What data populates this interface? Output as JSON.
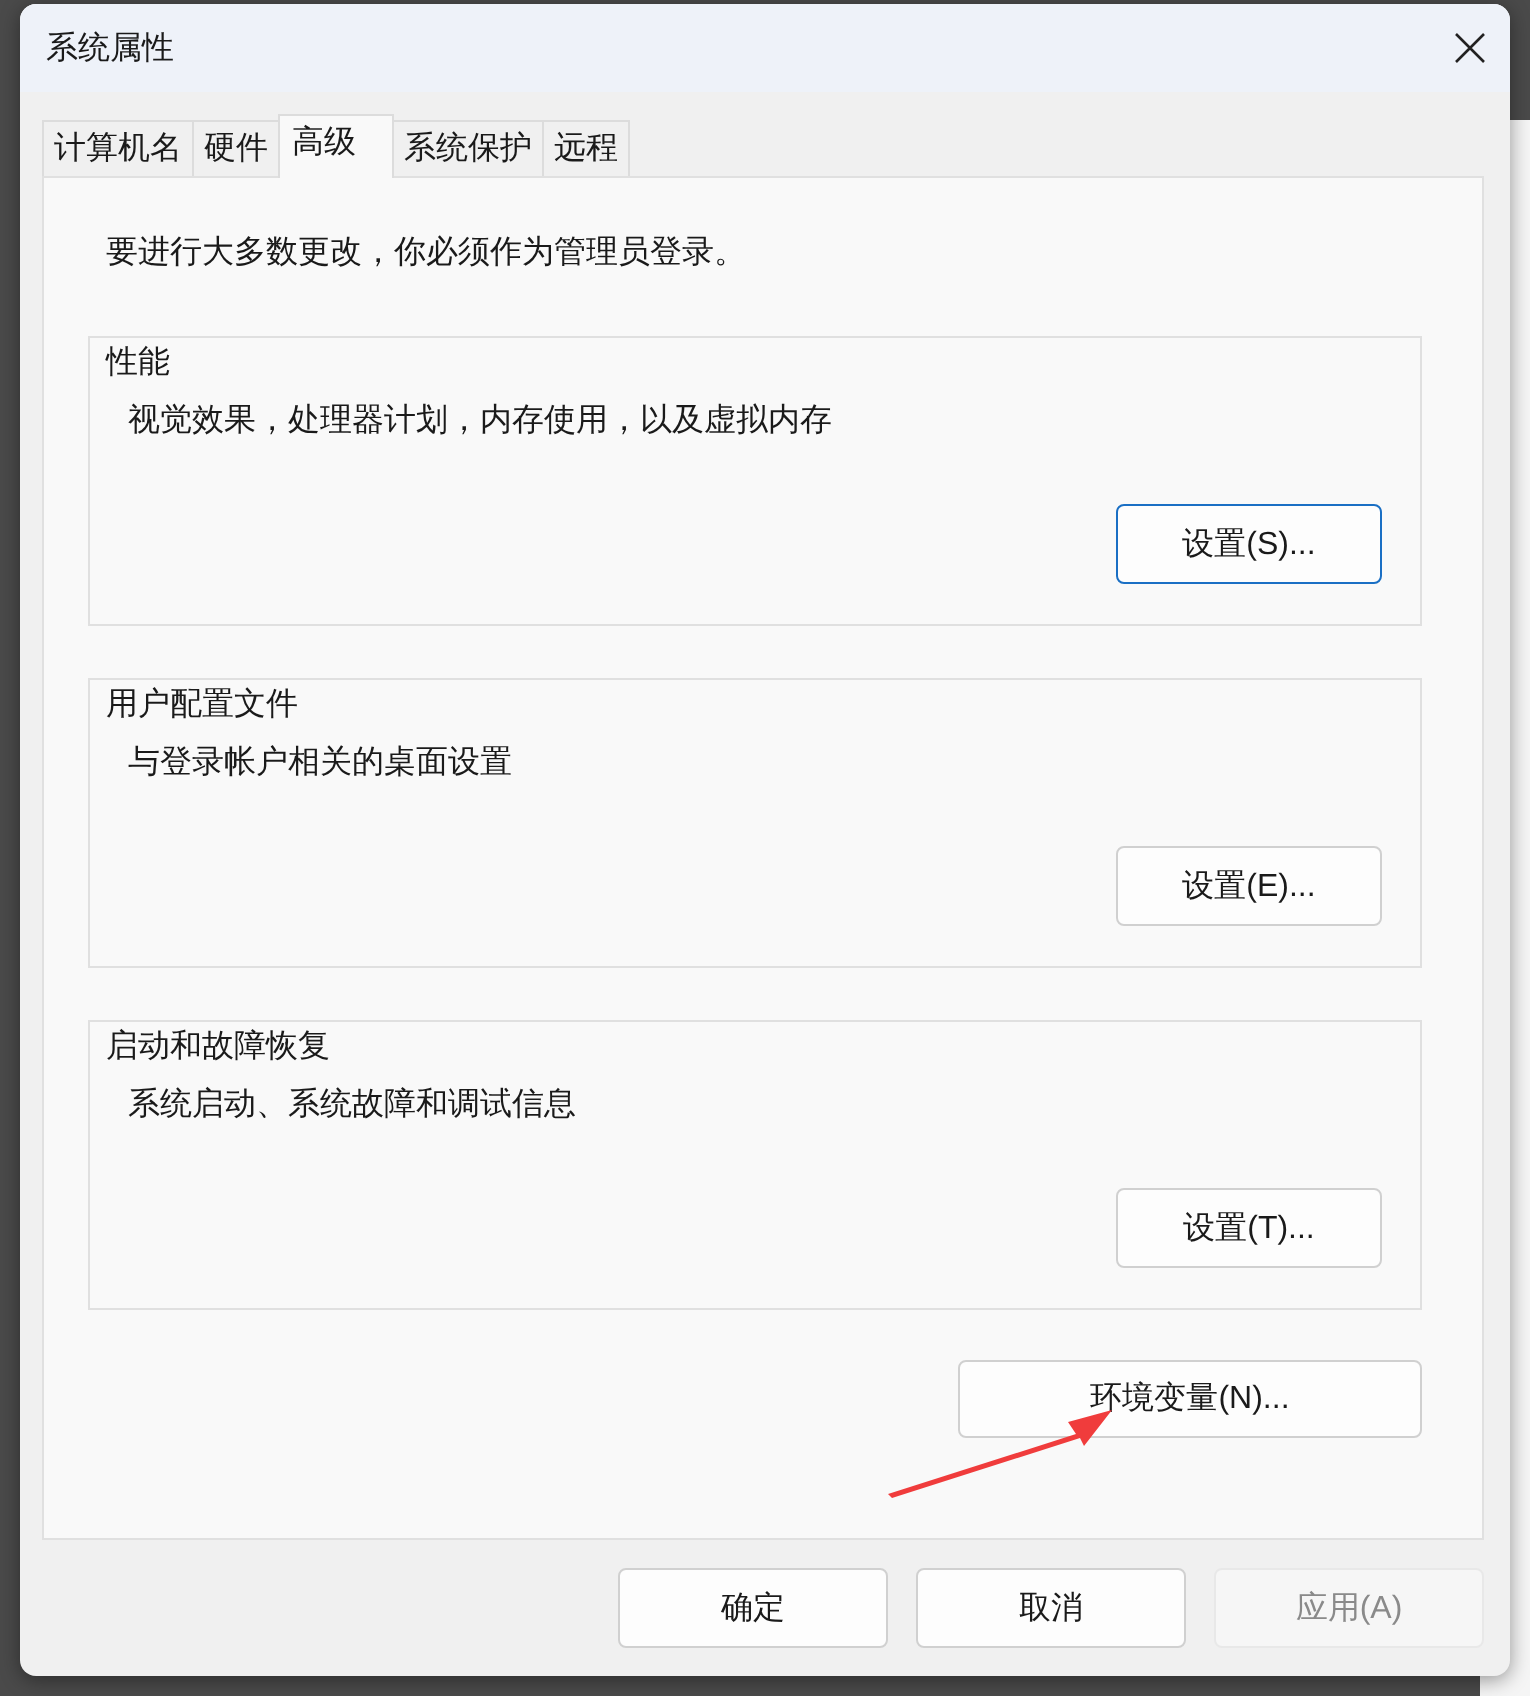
{
  "window": {
    "title": "系统属性"
  },
  "tabs": [
    {
      "label": "计算机名",
      "selected": false
    },
    {
      "label": "硬件",
      "selected": false
    },
    {
      "label": "高级",
      "selected": true
    },
    {
      "label": "系统保护",
      "selected": false
    },
    {
      "label": "远程",
      "selected": false
    }
  ],
  "notice": "要进行大多数更改，你必须作为管理员登录。",
  "groups": [
    {
      "title": "性能",
      "description": "视觉效果，处理器计划，内存使用，以及虚拟内存",
      "button": "设置(S)...",
      "focused": true
    },
    {
      "title": "用户配置文件",
      "description": "与登录帐户相关的桌面设置",
      "button": "设置(E)...",
      "focused": false
    },
    {
      "title": "启动和故障恢复",
      "description": "系统启动、系统故障和调试信息",
      "button": "设置(T)...",
      "focused": false
    }
  ],
  "env_button": "环境变量(N)...",
  "footer_buttons": [
    {
      "label": "确定",
      "disabled": false
    },
    {
      "label": "取消",
      "disabled": false
    },
    {
      "label": "应用(A)",
      "disabled": true
    }
  ]
}
